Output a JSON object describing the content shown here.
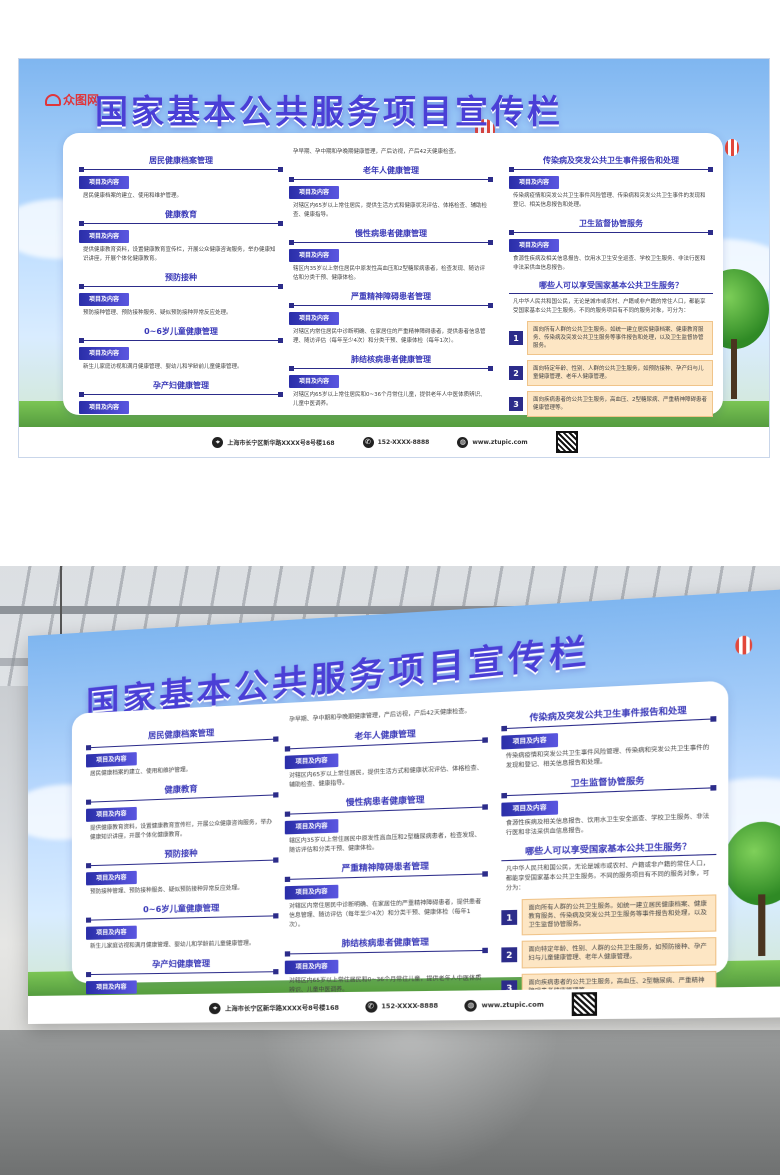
{
  "logo_text": "众图网",
  "title": "国家基本公共服务项目宣传栏",
  "tag_label": "项目及内容",
  "left_column": [
    {
      "heading": "居民健康档案管理",
      "text": "居民健康档案的建立、使用和维护管理。"
    },
    {
      "heading": "健康教育",
      "text": "提供健康教育资料，设置健康教育宣传栏，开展公众健康咨询服务，举办健康知识讲座，开展个体化健康教育。"
    },
    {
      "heading": "预防接种",
      "text": "预防接种管理、预防接种服务、疑似预防接种异常反应处理。"
    },
    {
      "heading": "0~6岁儿童健康管理",
      "text": "新生儿家庭访视和满月健康管理、婴幼儿和学龄前儿童健康管理。"
    },
    {
      "heading": "孕产妇健康管理",
      "text": ""
    }
  ],
  "middle_column": {
    "intro": "孕早期、孕中期和孕晚期健康管理，产后访视，产后42天健康检查。",
    "sections": [
      {
        "heading": "老年人健康管理",
        "text": "对辖区内65岁以上常住居民，提供生活方式和健康状况评估、体格检查、辅助检查、健康指导。"
      },
      {
        "heading": "慢性病患者健康管理",
        "text": "辖区内35岁以上常住居民中原发性高血压和2型糖尿病患者，检查发现、随访评估和分类干预、健康体检。"
      },
      {
        "heading": "严重精神障碍患者管理",
        "text": "对辖区内常住居民中诊断明确、在家居住的严重精神障碍患者，提供患者信息管理、随访评估（每年至少4次）和分类干预、健康体检（每年1次）。"
      },
      {
        "heading": "肺结核病患者健康管理",
        "text": "对辖区内65岁以上常住居民和0~36个月常住儿童，提供老年人中医体质辨识、儿童中医调养。"
      }
    ]
  },
  "right_column": {
    "sections": [
      {
        "heading": "传染病及突发公共卫生事件报告和处理",
        "text": "传染病疫情和突发公共卫生事件风险管理、传染病和突发公共卫生事件的发现和登记、相关信息报告和处理。"
      },
      {
        "heading": "卫生监督协管服务",
        "text": "食源性疾病及相关信息报告、饮用水卫生安全巡查、学校卫生服务、非法行医和非法采供血信息报告。"
      }
    ],
    "question": "哪些人可以享受国家基本公共卫生服务？",
    "question_text": "凡中华人民共和国公民，无论是城市或农村、户籍或非户籍的常住人口，都能享受国家基本公共卫生服务。不同的服务项目有不同的服务对象，可分为：",
    "services": [
      {
        "num": "1",
        "text": "面向所有人群的公共卫生服务。如统一建立居民健康档案、健康教育服务、传染病及突发公共卫生服务等事件报告和处理，以及卫生监督协管服务。"
      },
      {
        "num": "2",
        "text": "面向特定年龄、性别、人群的公共卫生服务，如预防接种、孕产妇与儿童健康管理、老年人健康管理。"
      },
      {
        "num": "3",
        "text": "面向疾病患者的公共卫生服务，高血压、2型糖尿病、严重精神障碍患者健康管理等。"
      }
    ]
  },
  "footer": {
    "address": "上海市长宁区新华路XXXX号8号楼168",
    "phone": "152-XXXX-8888",
    "website": "www.ztupic.com"
  },
  "colors": {
    "title": "#4a3fd6",
    "heading": "#3a39b8",
    "tag": "#2a2ea8",
    "service_box": "#fde6c4"
  }
}
